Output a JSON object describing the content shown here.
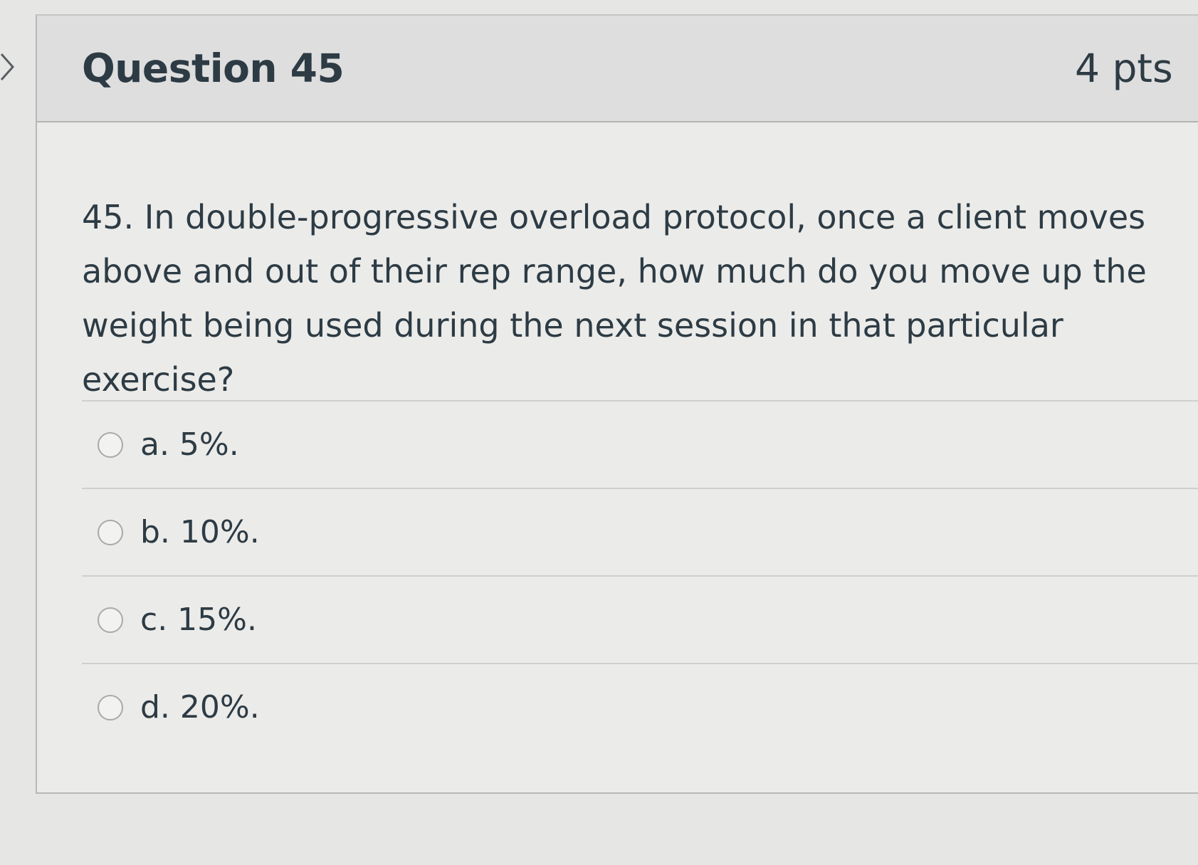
{
  "nav": {
    "expand_icon": "chevron-right-icon"
  },
  "question": {
    "title": "Question 45",
    "points": "4 pts",
    "text": "45. In double-progressive overload protocol, once a client moves above and out of their rep range, how much do you move up the weight being used during the next session in that particular exercise?",
    "answers": [
      {
        "label": "a. 5%."
      },
      {
        "label": "b. 10%."
      },
      {
        "label": "c. 15%."
      },
      {
        "label": "d. 20%."
      }
    ]
  },
  "colors": {
    "text": "#2d3b45",
    "header_bg": "#dedede",
    "page_bg": "#e6e6e4"
  }
}
